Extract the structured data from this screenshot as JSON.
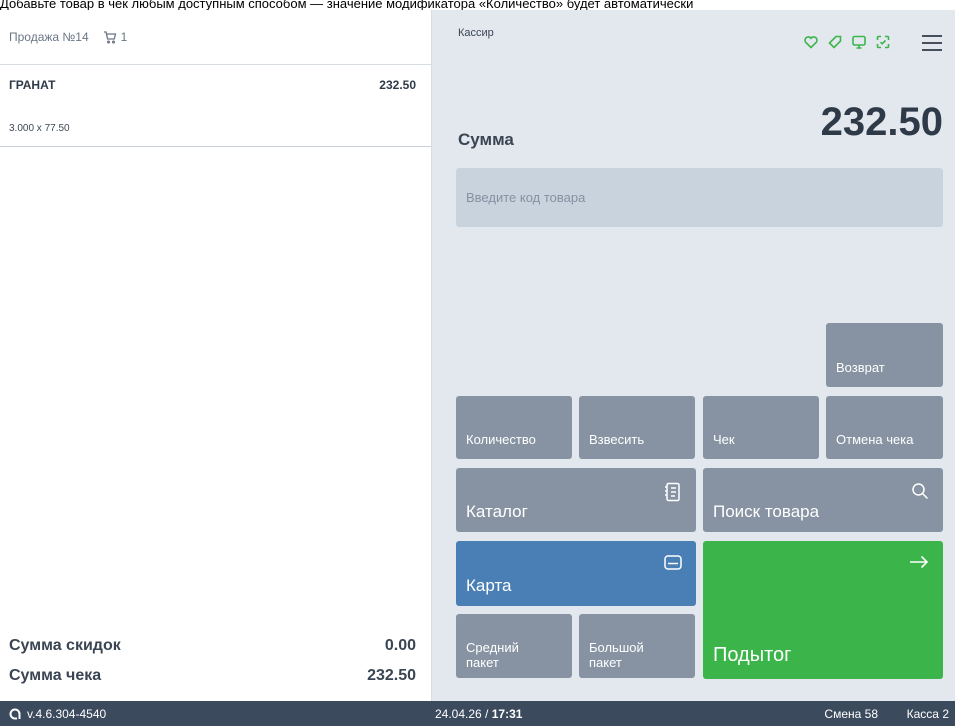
{
  "top_banner": "Добавьте товар в чек любым доступным способом — значение модификатора «Количество» будет автоматически",
  "receipt": {
    "title": "Продажа №14",
    "cart_count": "1",
    "items": [
      {
        "name": "ГРАНАТ",
        "total": "232.50",
        "detail": "3.000 x 77.50"
      }
    ],
    "discount_label": "Сумма скидок",
    "discount_value": "0.00",
    "check_sum_label": "Сумма чека",
    "check_sum_value": "232.50"
  },
  "cashier": {
    "title": "Кассир",
    "status_icons": [
      "heart-icon",
      "tag-icon",
      "display-icon",
      "scan-icon"
    ],
    "menu_icon": "hamburger-menu-icon"
  },
  "sum": {
    "label": "Сумма",
    "value": "232.50"
  },
  "search": {
    "placeholder": "Введите код товара"
  },
  "buttons": {
    "return": "Возврат",
    "quantity": "Количество",
    "weigh": "Взвесить",
    "check": "Чек",
    "cancel_check": "Отмена чека",
    "catalog": "Каталог",
    "search_product": "Поиск товара",
    "card": "Карта",
    "medium_bag": "Средний пакет",
    "big_bag": "Большой пакет",
    "subtotal": "Подытог"
  },
  "footer": {
    "version": "v.4.6.304-4540",
    "date": "24.04.26",
    "time": "17:31",
    "shift": "Смена 58",
    "register": "Касса 2"
  },
  "colors": {
    "accent_green": "#3bb54a",
    "card_blue": "#4a7fb5",
    "button_gray": "#8793a2",
    "panel_bg": "#e5eaf0",
    "footer_bg": "#3c4a5e"
  }
}
